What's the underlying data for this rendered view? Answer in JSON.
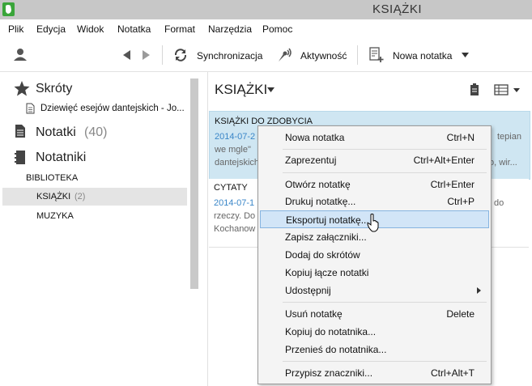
{
  "window": {
    "title": "KSIĄŻKI",
    "app_icon": "elephant-icon"
  },
  "menu": [
    "Plik",
    "Edycja",
    "Widok",
    "Notatka",
    "Format",
    "Narzędzia",
    "Pomoc"
  ],
  "toolbar": {
    "account_icon": "person-icon",
    "back_icon": "back-arrow-icon",
    "forward_icon": "forward-arrow-icon",
    "sync_label": "Synchronizacja",
    "activity_label": "Aktywność",
    "new_note_label": "Nowa notatka"
  },
  "sidebar": {
    "shortcuts_label": "Skróty",
    "shortcut_item": "Dziewięć esejów dantejskich - Jo...",
    "notes_label": "Notatki",
    "notes_count": "(40)",
    "notebooks_label": "Notatniki",
    "library_label": "BIBLIOTEKA",
    "notebooks": [
      {
        "label": "KSIĄŻKI",
        "count": "(2)"
      },
      {
        "label": "MUZYKA",
        "count": ""
      }
    ]
  },
  "notelist": {
    "title": "KSIĄŻKI",
    "notes": [
      {
        "title": "KSIĄŻKI DO ZDOBYCIA",
        "date": "2014-07-2",
        "snip1_start": "we mgle\"",
        "snip1_end": "tepian",
        "snip2_start": "dantejskich",
        "snip2_end": "o, wir..."
      },
      {
        "title": "CYTATY",
        "date": "2014-07-1",
        "snip1_start": "rzeczy. Do",
        "snip1_end": "do",
        "snip2_start": "Kochanow",
        "snip2_end": ""
      }
    ]
  },
  "context_menu": {
    "items": [
      {
        "label": "Nowa notatka",
        "shortcut": "Ctrl+N"
      },
      {
        "label": "Zaprezentuj",
        "shortcut": "Ctrl+Alt+Enter"
      },
      {
        "label": "Otwórz notatkę",
        "shortcut": "Ctrl+Enter"
      },
      {
        "label": "Drukuj notatkę...",
        "shortcut": "Ctrl+P"
      },
      {
        "label": "Eksportuj notatkę...",
        "shortcut": ""
      },
      {
        "label": "Zapisz załączniki...",
        "shortcut": ""
      },
      {
        "label": "Dodaj do skrótów",
        "shortcut": ""
      },
      {
        "label": "Kopiuj łącze notatki",
        "shortcut": ""
      },
      {
        "label": "Udostępnij",
        "shortcut": ""
      },
      {
        "label": "Usuń notatkę",
        "shortcut": "Delete"
      },
      {
        "label": "Kopiuj do notatnika...",
        "shortcut": ""
      },
      {
        "label": "Przenieś do notatnika...",
        "shortcut": ""
      },
      {
        "label": "Przypisz znaczniki...",
        "shortcut": "Ctrl+Alt+T"
      }
    ]
  },
  "colors": {
    "selected_note_bg": "#cfe6f2",
    "date_blue": "#3a86c8",
    "menu_highlight": "#d2e5f7"
  }
}
